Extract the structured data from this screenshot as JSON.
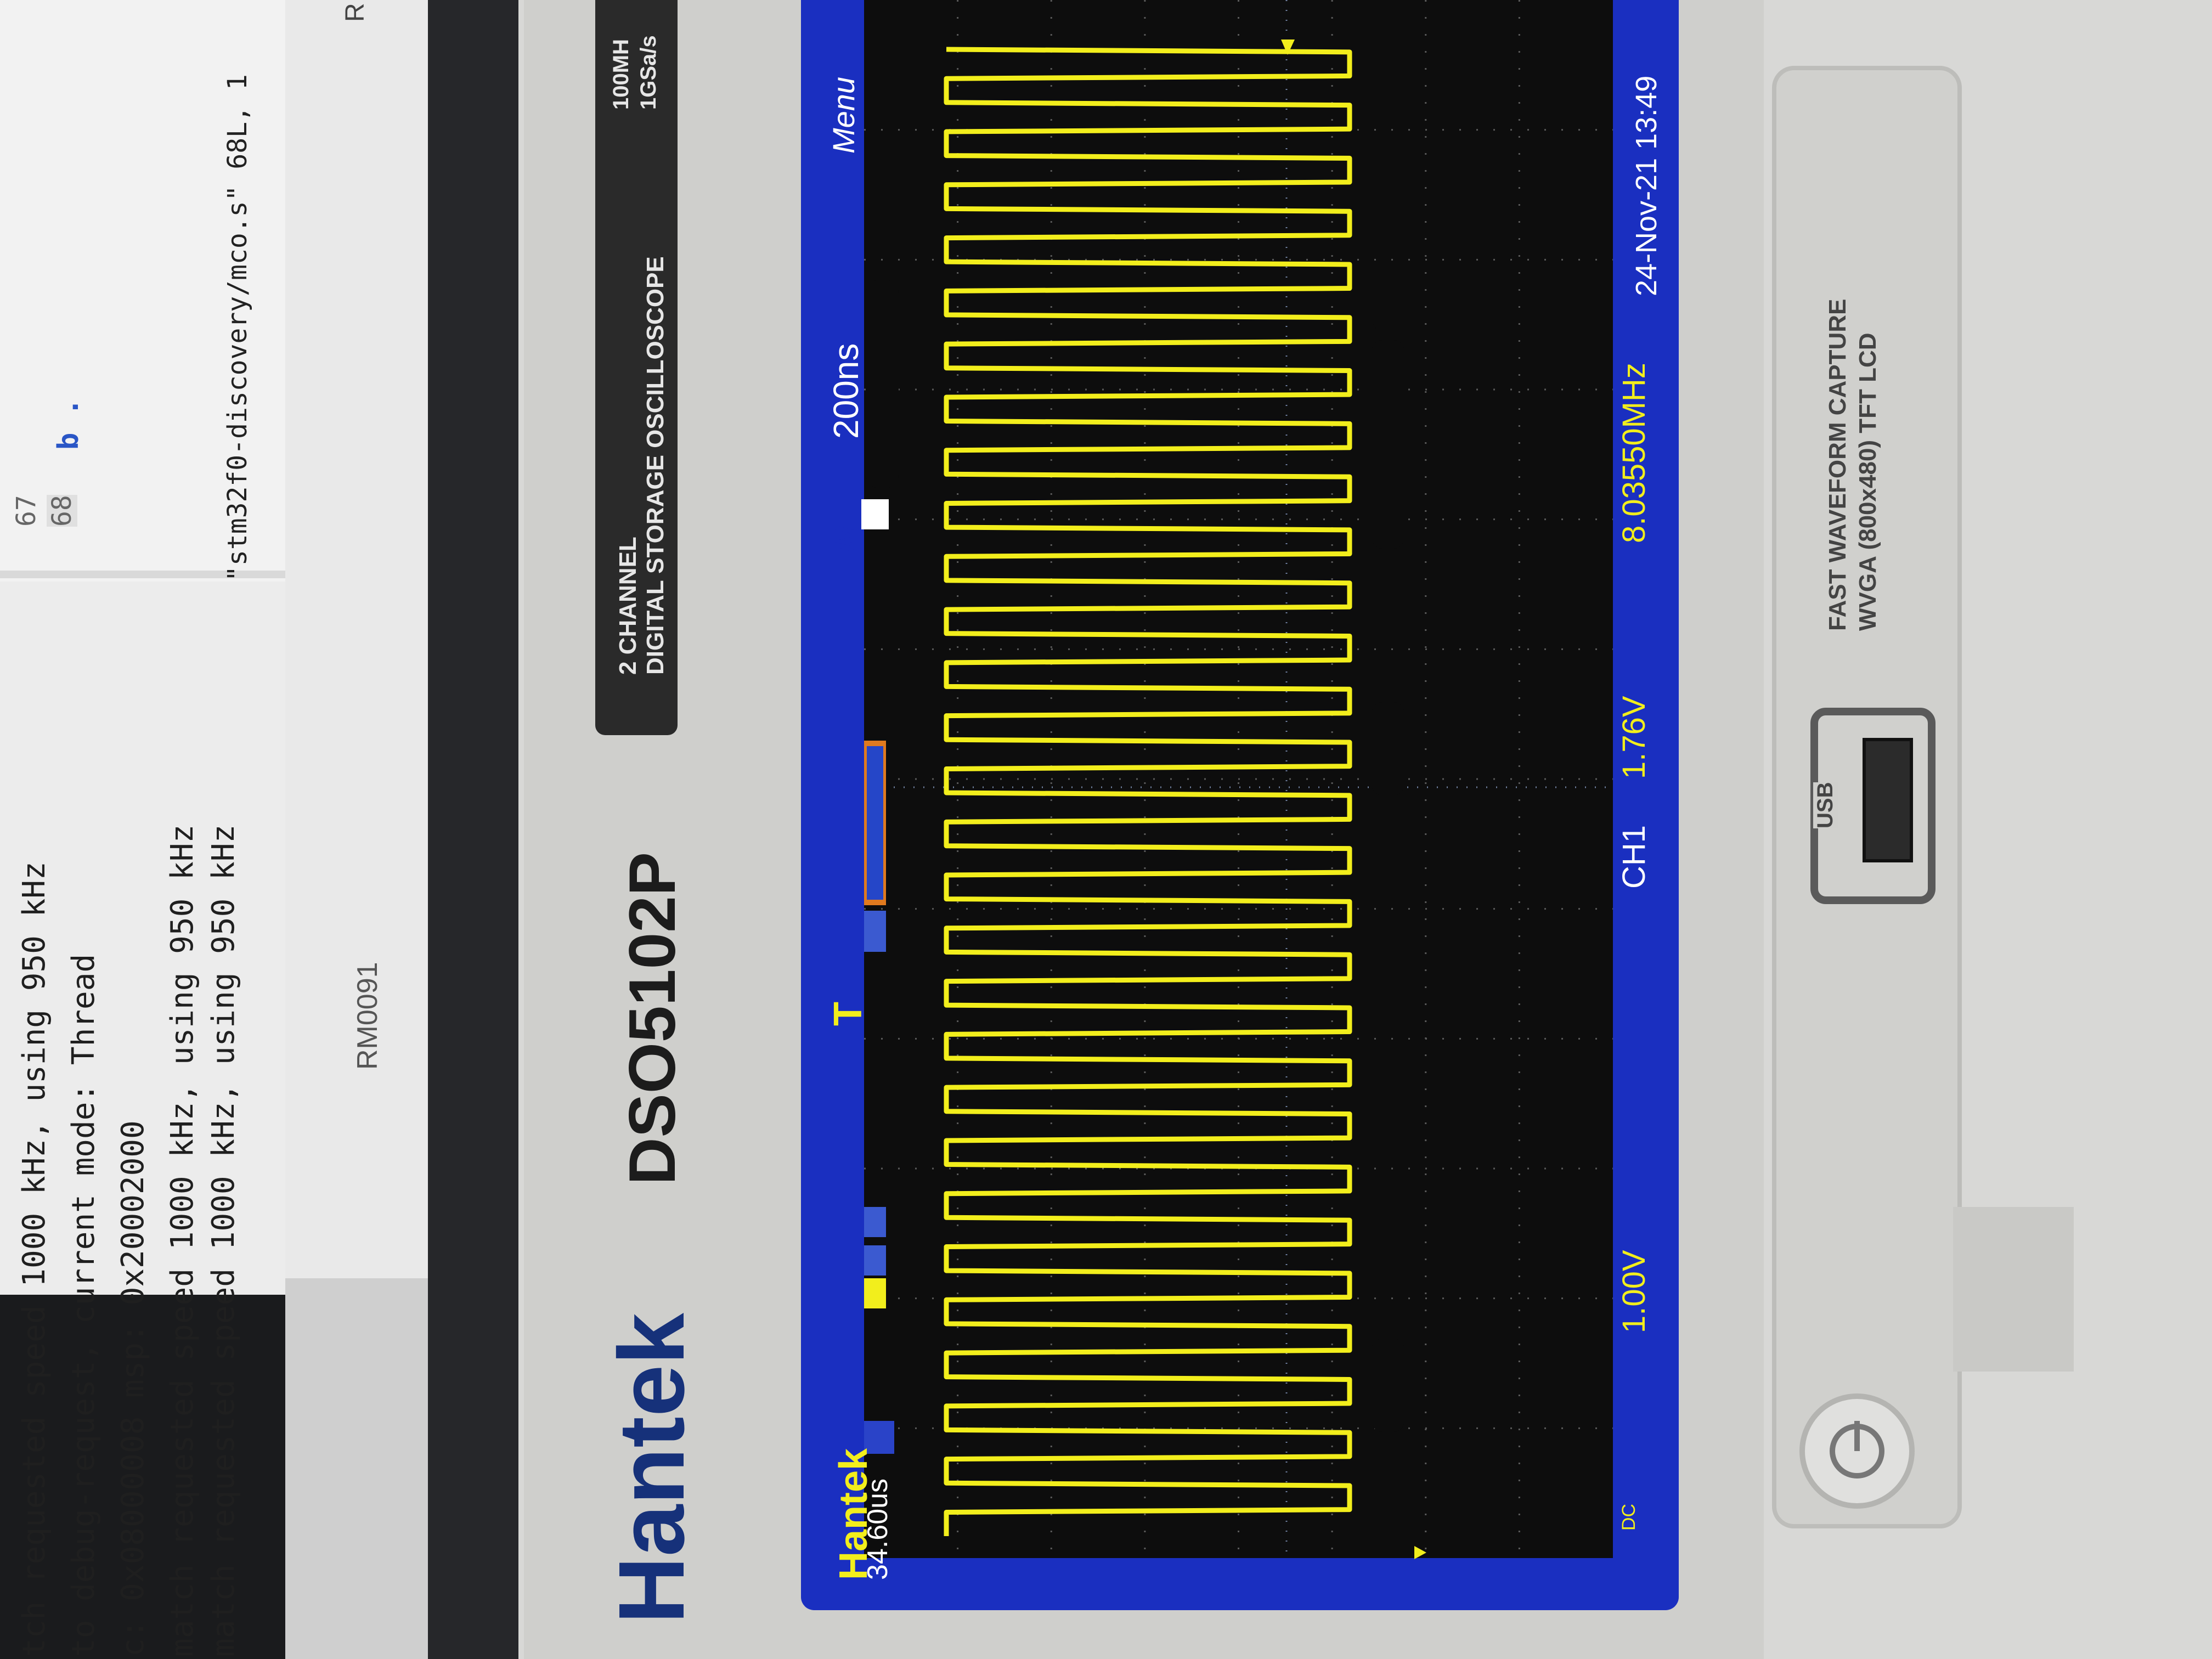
{
  "monitor": {
    "editor_line_numbers": [
      "67",
      "68"
    ],
    "editor_code": "b .",
    "label": "RM0091",
    "status_text": "\"stm32f0-discovery/mco.s\" 68L, 1",
    "side_letter": "R",
    "terminal_lines": [
      "tch requested speed 1000 kHz, using 950 kHz",
      "to debug-request, current mode: Thread",
      "c: 0x08000008 msp: 0x20002000",
      "match requested speed 1000 kHz, using 950 kHz",
      "match requested speed 1000 kHz, using 950 kHz"
    ]
  },
  "scope": {
    "brand": "Hantek",
    "model": "DSO5102P",
    "subtitle_line1": "2 CHANNEL",
    "subtitle_line2": "DIGITAL STORAGE OSCILLOSCOPE",
    "spec_line1": "100MH",
    "spec_line2": "1GSa/s",
    "usb_label": "USB",
    "capture_line1": "FAST WAVEFORM CAPTURE",
    "capture_line2": "WVGA (800x480) TFT LCD",
    "screen": {
      "brand": "Hantek",
      "trigger_time": "34.60us",
      "timebase": "200ns",
      "window_mode": "W",
      "menu": "Menu",
      "channel": "CH1",
      "volts_per_div": "1.00V",
      "trigger_level": "1.76V",
      "frequency": "8.03550MHz",
      "datetime": "24-Nov-21 13:49",
      "coupling": "DC",
      "trigger_channel": "T",
      "waveform_color": "#f2ee1c",
      "screen_color": "#1a2fc0",
      "waveform_cycles": 28
    }
  }
}
